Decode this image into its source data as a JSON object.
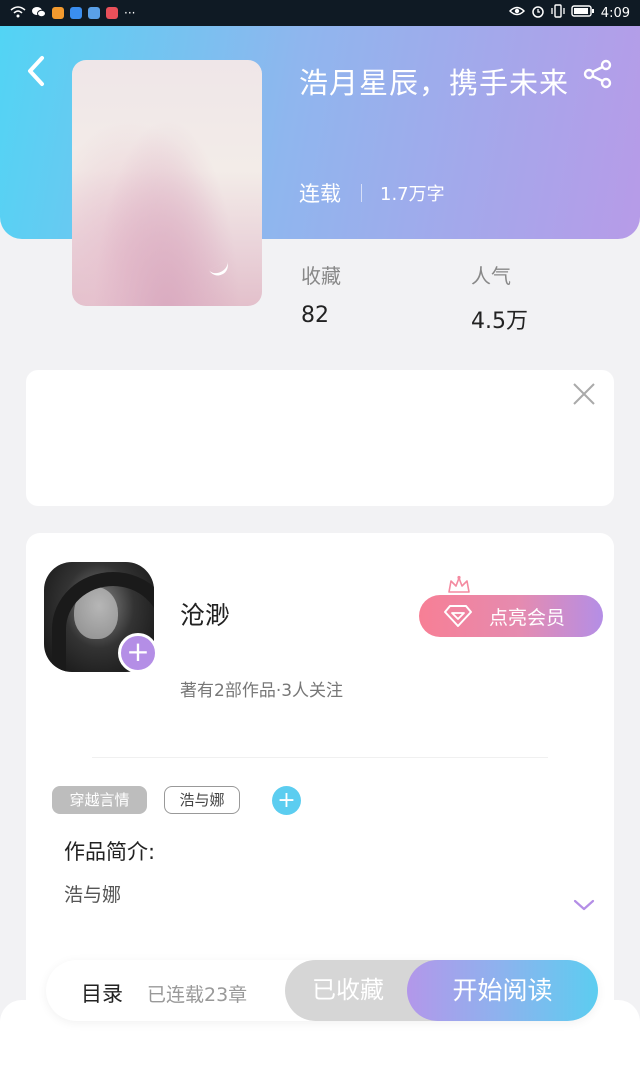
{
  "status_bar": {
    "left_icons": [
      "wifi-icon",
      "wechat-icon",
      "app-orange-icon",
      "app-blue-icon",
      "app-puzzle-icon",
      "app-red-icon",
      "more-dots-icon"
    ],
    "more": "···",
    "right_icons": [
      "eye-icon",
      "alarm-icon",
      "vibrate-icon",
      "battery-icon"
    ],
    "time": "4:09"
  },
  "book": {
    "title": "浩月星辰，携手未来",
    "status": "连载",
    "word_count": "1.7万字",
    "favorites_label": "收藏",
    "favorites_value": "82",
    "popularity_label": "人气",
    "popularity_value": "4.5万"
  },
  "author": {
    "name": "沧渺",
    "stats": "著有2部作品·3人关注",
    "follow_symbol": "+",
    "vip_button": "点亮会员"
  },
  "tags": {
    "genre": "穿越言情",
    "custom": "浩与娜",
    "add_symbol": "+"
  },
  "intro": {
    "heading": "作品简介:",
    "text": "浩与娜"
  },
  "bottom_bar": {
    "toc_label": "目录",
    "toc_status": "已连载23章",
    "collected_label": "已收藏",
    "read_label": "开始阅读"
  },
  "colors": {
    "accent_cyan": "#52d4f4",
    "accent_purple": "#b48ee6",
    "vip_pink": "#f77f95"
  }
}
